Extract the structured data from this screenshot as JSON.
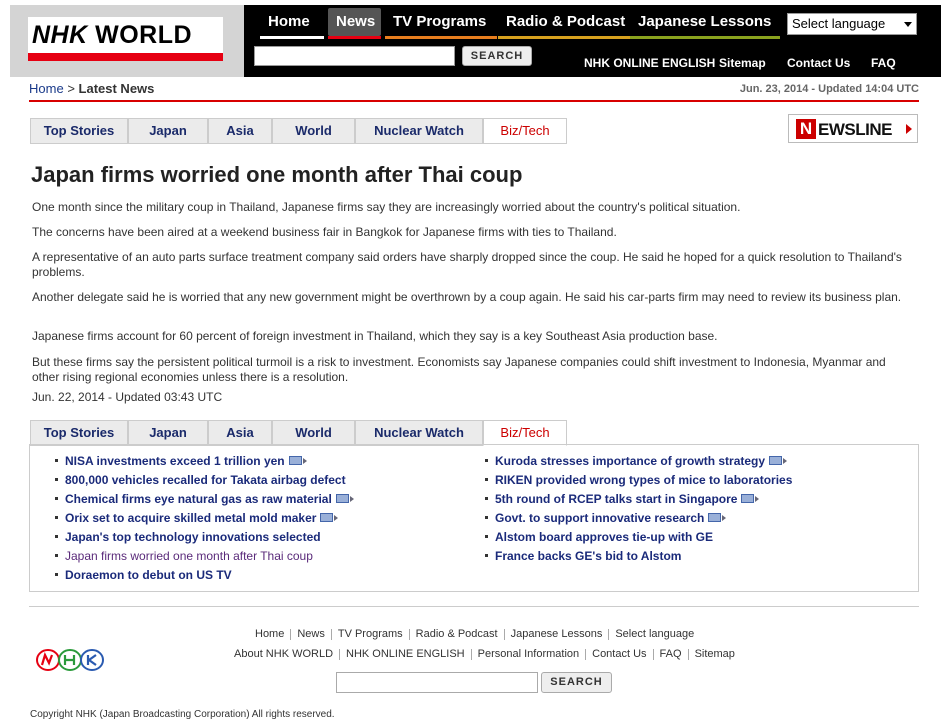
{
  "header": {
    "logo": {
      "nhk": "NHK",
      "world": "WORLD"
    },
    "nav_tabs": [
      {
        "label": "Home",
        "color": "#ffffff"
      },
      {
        "label": "News",
        "color": "#e60012",
        "active": true
      },
      {
        "label": "TV Programs",
        "color": "#e87e1e"
      },
      {
        "label": "Radio & Podcast",
        "color": "#d7a11e"
      },
      {
        "label": "Japanese Lessons",
        "color": "#8aa21e"
      }
    ],
    "language_select": "Select language",
    "search_button": "SEARCH",
    "links": [
      "NHK ONLINE ENGLISH",
      "Sitemap",
      "Contact Us",
      "FAQ"
    ]
  },
  "breadcrumb": {
    "home": "Home",
    "separator": ">",
    "current": "Latest News"
  },
  "updated_top": "Jun. 23, 2014 - Updated 14:04 UTC",
  "category_tabs": [
    "Top Stories",
    "Japan",
    "Asia",
    "World",
    "Nuclear Watch",
    "Biz/Tech"
  ],
  "newsline": {
    "n": "N",
    "text": "EWSLINE"
  },
  "article": {
    "headline": "Japan firms worried one month after Thai coup",
    "paragraphs": [
      "One month since the military coup in Thailand, Japanese firms say they are increasingly worried about the country's political situation.",
      "The concerns have been aired at a weekend business fair in Bangkok for Japanese firms with ties to Thailand.",
      "A representative of an auto parts surface treatment company said orders have sharply dropped since the coup. He said he hoped for a quick resolution to Thailand's problems.",
      "Another delegate said he is worried that any new government might be overthrown by a coup again. He said his car-parts firm may need to review its business plan.",
      "Japanese firms account for 60 percent of foreign investment in Thailand, which they say is a key Southeast Asia production base.",
      "But these firms say the persistent political turmoil is a risk to investment. Economists say Japanese companies could shift investment to Indonesia, Myanmar and other rising regional economies unless there is a resolution."
    ],
    "date": "Jun. 22, 2014 - Updated 03:43 UTC"
  },
  "news_list": {
    "left": [
      {
        "title": "NISA investments exceed 1 trillion yen",
        "video": true
      },
      {
        "title": "800,000 vehicles recalled for Takata airbag defect",
        "video": false
      },
      {
        "title": "Chemical firms eye natural gas as raw material",
        "video": true
      },
      {
        "title": "Orix set to acquire skilled metal mold maker",
        "video": true
      },
      {
        "title": "Japan's top technology innovations selected",
        "video": false
      },
      {
        "title": "Japan firms worried one month after Thai coup",
        "video": false,
        "visited": true
      },
      {
        "title": "Doraemon to debut on US TV",
        "video": false
      }
    ],
    "right": [
      {
        "title": "Kuroda stresses importance of growth strategy",
        "video": true
      },
      {
        "title": "RIKEN provided wrong types of mice to laboratories",
        "video": false
      },
      {
        "title": "5th round of RCEP talks start in Singapore",
        "video": true
      },
      {
        "title": "Govt. to support innovative research",
        "video": true
      },
      {
        "title": "Alstom board approves tie-up with GE",
        "video": false
      },
      {
        "title": "France backs GE's bid to Alstom",
        "video": false
      }
    ]
  },
  "footer": {
    "row1": [
      "Home",
      "News",
      "TV Programs",
      "Radio & Podcast",
      "Japanese Lessons",
      "Select language"
    ],
    "row2": [
      "About NHK WORLD",
      "NHK ONLINE ENGLISH",
      "Personal Information",
      "Contact Us",
      "FAQ",
      "Sitemap"
    ],
    "search_button": "SEARCH",
    "copyright": "Copyright NHK (Japan Broadcasting Corporation) All rights reserved."
  }
}
